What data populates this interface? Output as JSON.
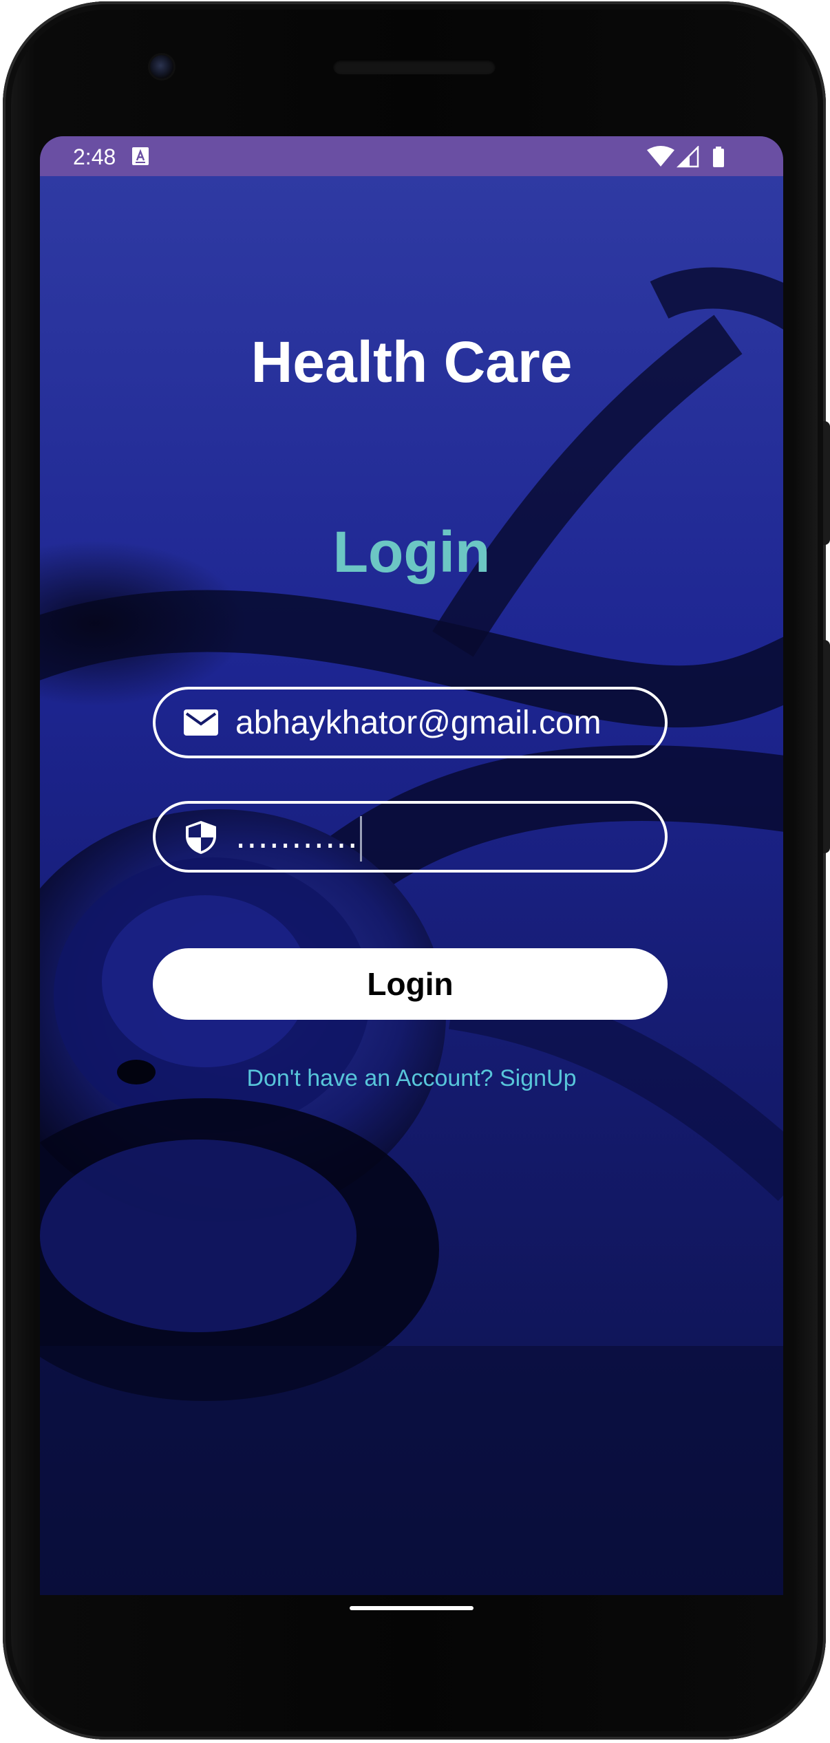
{
  "status_bar": {
    "time": "2:48",
    "notification_icon": "keyboard-a-icon",
    "icons": [
      "wifi-icon",
      "signal-icon",
      "battery-icon"
    ],
    "color": "#6a4fa3"
  },
  "app": {
    "title": "Health Care",
    "subtitle": "Login",
    "email": {
      "value": "abhaykhator@gmail.com",
      "icon": "mail-icon"
    },
    "password": {
      "masked_value": "...........",
      "icon": "shield-icon"
    },
    "login_button_label": "Login",
    "signup_link": "Don't have an Account? SignUp",
    "background": "stethoscope-photo",
    "colors": {
      "title": "#ffffff",
      "subtitle": "#6cc6c4",
      "link": "#58c6da",
      "background": "#1a2290"
    }
  }
}
